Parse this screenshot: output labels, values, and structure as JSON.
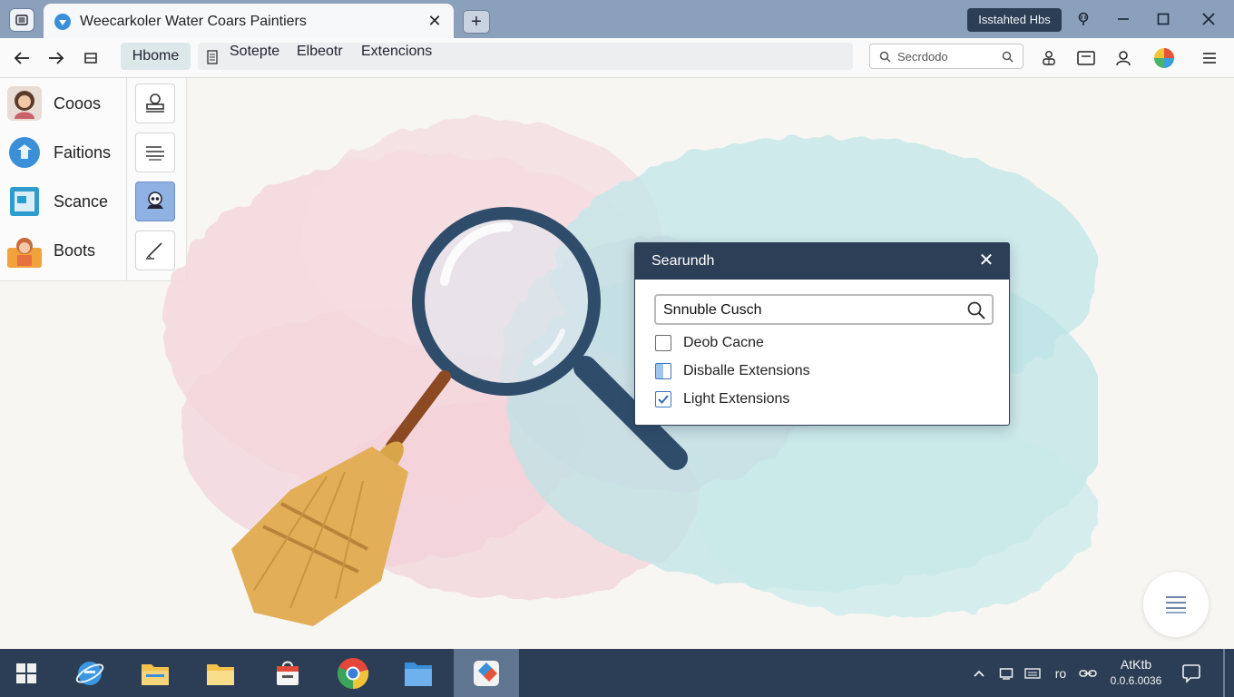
{
  "browser": {
    "tab_title": "Weecarkoler Water Coars Paintiers",
    "profile_chip": "Isstahted Hbs",
    "address": {
      "home": "Hbome",
      "items": [
        "Sotepte",
        "Elbeotr",
        "Extencions"
      ]
    },
    "search_placeholder": "Secrdodo"
  },
  "sidebar": {
    "items": [
      {
        "label": "Cooos",
        "icon": "person-avatar-icon"
      },
      {
        "label": "Faitions",
        "icon": "shield-badge-icon"
      },
      {
        "label": "Scance",
        "icon": "image-frame-icon"
      },
      {
        "label": "Boots",
        "icon": "person-orange-icon"
      }
    ]
  },
  "tools": [
    "stamp-tool-icon",
    "lines-tool-icon",
    "skull-tool-icon",
    "pen-tool-icon"
  ],
  "dialog": {
    "title": "Searundh",
    "search_value": "Snnuble Cusch",
    "options": [
      {
        "label": "Deob Cacne",
        "state": "unchecked"
      },
      {
        "label": "Disballe Extensions",
        "state": "partial"
      },
      {
        "label": "Light Extensions",
        "state": "checked"
      }
    ]
  },
  "taskbar": {
    "clock_time": "AtKtb",
    "clock_date": "0.0.6.0036",
    "tray_text": "ro"
  },
  "colors": {
    "titlebar": "#8aa0bb",
    "taskbar": "#2b3e55",
    "dialog_header": "#2c3f57",
    "accent": "#3a77c1",
    "cloud_pink": "#f3d5db",
    "cloud_teal": "#bfe5e6"
  }
}
